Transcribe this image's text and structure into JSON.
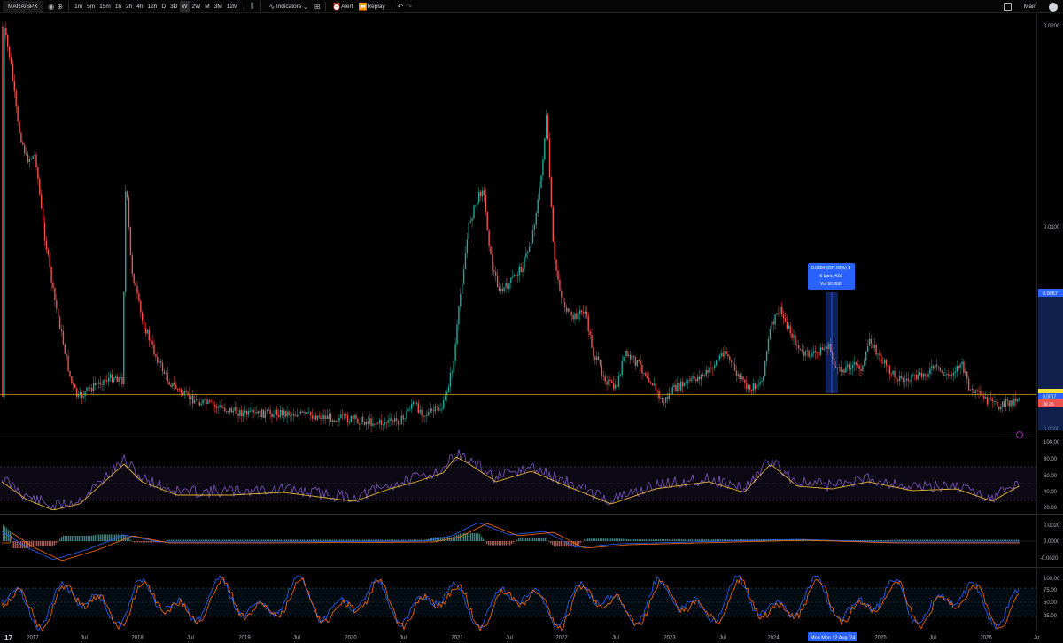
{
  "toolbar": {
    "symbol": "MARA/SPX",
    "timeframes": [
      "1m",
      "5m",
      "15m",
      "1h",
      "2h",
      "4h",
      "12h",
      "D",
      "3D",
      "W",
      "2W",
      "M",
      "3M",
      "12M"
    ],
    "active_timeframe": "W",
    "indicators_label": "Indicators",
    "alert_label": "Alert",
    "replay_label": "Replay",
    "layout_label": "Main"
  },
  "price_axis": {
    "ticks": [
      "0.0200",
      "0.0100",
      "0.0000"
    ],
    "highlight_label": "0.0067",
    "current_price": "0.0017",
    "countdown": "3d 2h"
  },
  "rsi_axis": {
    "ticks": [
      "100.00",
      "80.00",
      "60.00",
      "40.00",
      "20.00"
    ]
  },
  "macd_axis": {
    "ticks": [
      "0.0020",
      "0.0000",
      "-0.0020"
    ]
  },
  "stoch_axis": {
    "ticks": [
      "100.00",
      "75.00",
      "50.00",
      "25.00"
    ]
  },
  "time_axis": {
    "labels": [
      "2017",
      "Jul",
      "2018",
      "Jul",
      "2019",
      "Jul",
      "2020",
      "Jul",
      "2021",
      "Jul",
      "2022",
      "Jul",
      "2023",
      "Jul",
      "2024",
      "Jul",
      "2025",
      "Jul",
      "2026",
      "Ju"
    ],
    "crosshair_label": "Mon  Mon 12 Aug '24"
  },
  "measure_tooltip": {
    "line1": "0.0050 (297.03%) 1",
    "line2": "6 bars, 42d",
    "line3": "Vol 90.08B"
  },
  "colors": {
    "up": "#26a69a",
    "down": "#ef5350",
    "rsi": "#7e57c2",
    "ma": "#e0b030",
    "macd": "#2962ff",
    "signal": "#ff6d00",
    "accent": "#2962ff"
  }
}
